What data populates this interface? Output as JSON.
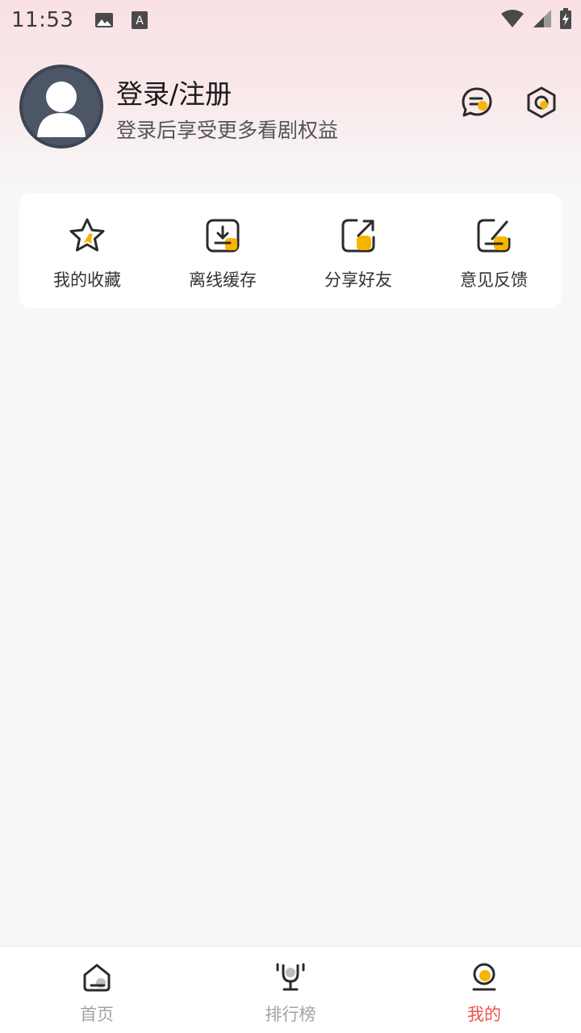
{
  "status_bar": {
    "time": "11:53",
    "icons": [
      "image-icon",
      "font-icon",
      "wifi-icon",
      "signal-icon",
      "battery-icon"
    ]
  },
  "profile": {
    "title": "登录/注册",
    "subtitle": "登录后享受更多看剧权益",
    "buttons": [
      "message-icon",
      "settings-icon"
    ]
  },
  "quick_actions": [
    {
      "label": "我的收藏",
      "icon": "star-icon"
    },
    {
      "label": "离线缓存",
      "icon": "download-icon"
    },
    {
      "label": "分享好友",
      "icon": "share-icon"
    },
    {
      "label": "意见反馈",
      "icon": "feedback-icon"
    }
  ],
  "bottom_nav": {
    "items": [
      {
        "label": "首页",
        "icon": "home-icon",
        "active": false
      },
      {
        "label": "排行榜",
        "icon": "trophy-icon",
        "active": false
      },
      {
        "label": "我的",
        "icon": "profile-icon",
        "active": true
      }
    ]
  },
  "colors": {
    "accent_yellow": "#f7b500",
    "active_red": "#ef5350",
    "inactive_gray": "#a3a3a3",
    "header_pink": "#f9e1e4"
  }
}
